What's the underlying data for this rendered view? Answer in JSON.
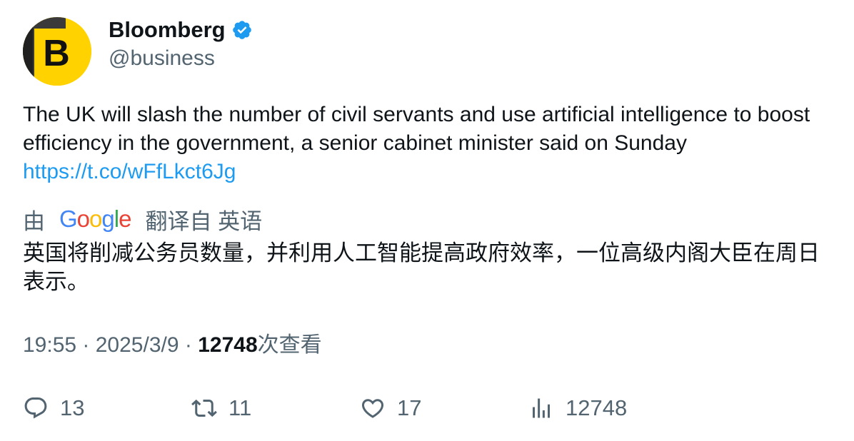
{
  "author": {
    "display_name": "Bloomberg",
    "handle": "@business",
    "avatar_letter": "B",
    "verified": true,
    "avatar_color": "#ffd200"
  },
  "tweet": {
    "text": "The UK will slash the number of civil servants and use artificial intelligence to boost efficiency in the government, a senior cabinet minister said on Sunday",
    "link": "https://t.co/wFfLkct6Jg"
  },
  "translation": {
    "prefix": "由",
    "provider_logo": "Google",
    "suffix": "翻译自 英语",
    "text": "英国将削减公务员数量，并利用人工智能提高政府效率，一位高级内阁大臣在周日表示。"
  },
  "meta": {
    "time": "19:55",
    "separator": " · ",
    "date": "2025/3/9",
    "views_count": "12748",
    "views_label": "次查看"
  },
  "actions": {
    "reply": {
      "icon": "reply-icon",
      "count": "13"
    },
    "retweet": {
      "icon": "retweet-icon",
      "count": "11"
    },
    "like": {
      "icon": "heart-icon",
      "count": "17"
    },
    "views": {
      "icon": "analytics-icon",
      "count": "12748"
    }
  },
  "colors": {
    "text_primary": "#0f1419",
    "text_secondary": "#536471",
    "link": "#1d9bf0",
    "verified_badge": "#1d9bf0"
  }
}
